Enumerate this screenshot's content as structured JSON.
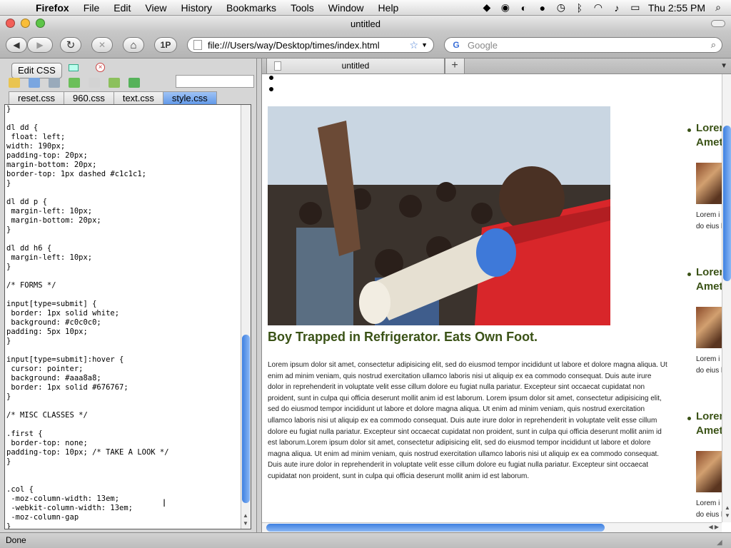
{
  "menubar": {
    "apple_glyph": "",
    "items": [
      "Firefox",
      "File",
      "Edit",
      "View",
      "History",
      "Bookmarks",
      "Tools",
      "Window",
      "Help"
    ],
    "clock": "Thu 2:55 PM"
  },
  "window": {
    "title": "untitled"
  },
  "navbar": {
    "back_glyph": "◀",
    "forward_glyph": "▶",
    "reload_glyph": "↻",
    "stop_glyph": "✕",
    "home_glyph": "⌂",
    "onepassword_label": "1P",
    "url": "file:///Users/way/Desktop/times/index.html",
    "search_placeholder": "Google",
    "search_logo": "G"
  },
  "sidebar": {
    "title": "Edit CSS",
    "close_glyph": "×",
    "tabs": [
      "reset.css",
      "960.css",
      "text.css",
      "style.css"
    ],
    "active_tab": "style.css",
    "code": "}\n\ndl dd {\n float: left;\nwidth: 190px;\npadding-top: 20px;\nmargin-bottom: 20px;\nborder-top: 1px dashed #c1c1c1;\n}\n\ndl dd p {\n margin-left: 10px;\n margin-bottom: 20px;\n}\n\ndl dd h6 {\n margin-left: 10px;\n}\n\n/* FORMS */\n\ninput[type=submit] {\n border: 1px solid white;\n background: #c0c0c0;\npadding: 5px 10px;\n}\n\ninput[type=submit]:hover {\n cursor: pointer;\n background: #aaa8a8;\n border: 1px solid #676767;\n}\n\n/* MISC CLASSES */\n\n.first {\n border-top: none;\npadding-top: 10px; /* TAKE A LOOK */\n}\n\n\n.col {\n -moz-column-width: 13em;\n -webkit-column-width: 13em;\n -moz-column-gap\n}"
  },
  "status": {
    "text": "Done"
  },
  "browser": {
    "tab_title": "untitled",
    "new_tab_glyph": "+",
    "headline": "Boy Trapped in Refrigerator. Eats Own Foot.",
    "body": "Lorem ipsum dolor sit amet, consectetur adipisicing elit, sed do eiusmod tempor incididunt ut labore et dolore magna aliqua. Ut enim ad minim veniam, quis nostrud exercitation ullamco laboris nisi ut aliquip ex ea commodo consequat. Duis aute irure dolor in reprehenderit in voluptate velit esse cillum dolore eu fugiat nulla pariatur. Excepteur sint occaecat cupidatat non proident, sunt in culpa qui officia deserunt mollit anim id est laborum. Lorem ipsum dolor sit amet, consectetur adipisicing elit, sed do eiusmod tempor incididunt ut labore et dolore magna aliqua. Ut enim ad minim veniam, quis nostrud exercitation ullamco laboris nisi ut aliquip ex ea commodo consequat. Duis aute irure dolor in reprehenderit in voluptate velit esse cillum dolore eu fugiat nulla pariatur. Excepteur sint occaecat cupidatat non proident, sunt in culpa qui officia deserunt mollit anim id est laborum.Lorem ipsum dolor sit amet, consectetur adipisicing elit, sed do eiusmod tempor incididunt ut labore et dolore magna aliqua. Ut enim ad minim veniam, quis nostrud exercitation ullamco laboris nisi ut aliquip ex ea commodo consequat. Duis aute irure dolor in reprehenderit in voluptate velit esse cillum dolore eu fugiat nulla pariatur. Excepteur sint occaecat cupidatat non proident, sunt in culpa qui officia deserunt mollit anim id est laborum.",
    "side_items": [
      {
        "title": "Lorem Amet",
        "text": "Lorem i consect do eius labore e"
      },
      {
        "title": "Lorem Amet",
        "text": "Lorem i consect do eius labore e"
      },
      {
        "title": "Lorem Amet",
        "text": "Lorem i consect do eius labore e"
      }
    ]
  },
  "colors": {
    "headline": "#3a5216",
    "scroll_thumb": "#3d7fe0",
    "active_tab": "#5f97e8"
  }
}
